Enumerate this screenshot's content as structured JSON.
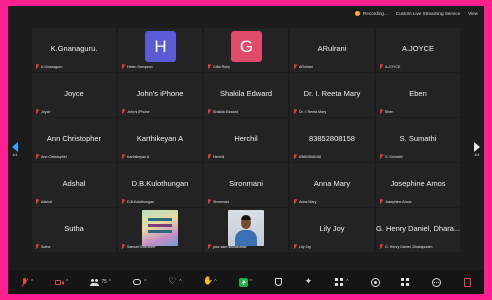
{
  "topbar": {
    "recording": "Recording...",
    "streaming": "Custom Live Streaming Service",
    "view": "View"
  },
  "nav": {
    "left_page": "4/4",
    "right_page": "4/4"
  },
  "participants": [
    {
      "name": "K.Gnanaguru.",
      "label": "K.Gnanaguru"
    },
    {
      "avatar": "H",
      "color": "#5b5bd6",
      "label": "Helen Sampson"
    },
    {
      "avatar": "G",
      "color": "#e04b6c",
      "label": "Gifta Ruby"
    },
    {
      "name": "ARulrani",
      "label": "ARulrani"
    },
    {
      "name": "A.JOYCE",
      "label": "A.JOYCE"
    },
    {
      "name": "Joyce",
      "label": "Joyce"
    },
    {
      "name": "John's iPhone",
      "label": "John's iPhone"
    },
    {
      "name": "Shakila Edward",
      "label": "Shakila Edward"
    },
    {
      "name": "Dr. I. Reeta Mary",
      "label": "Dr. I. Reeta Mary"
    },
    {
      "name": "Eben",
      "label": "Eben"
    },
    {
      "name": "Ann Christopher",
      "label": "Ann Christopher"
    },
    {
      "name": "Karthikeyan A",
      "label": "Karthikeyan A"
    },
    {
      "name": "Herchil",
      "label": "Herchil"
    },
    {
      "name": "83852808158",
      "label": "83852808158"
    },
    {
      "name": "S. Sumathi",
      "label": "S. Sumathi"
    },
    {
      "name": "Adshal",
      "label": "Adshal"
    },
    {
      "name": "D.B.Kulothungan",
      "label": "D.B.Kulothungan"
    },
    {
      "name": "Sironmani",
      "label": "Sironmani"
    },
    {
      "name": "Anna Mary",
      "label": "Anna Mary"
    },
    {
      "name": "Josephine Amos",
      "label": "Josephine Amos"
    },
    {
      "name": "Sutha",
      "label": "Sutha"
    },
    {
      "photo": "book",
      "label": "Samuel Ebenezer"
    },
    {
      "photo": "person",
      "label": "jose sam selvakumar"
    },
    {
      "name": "Lily Joy",
      "label": "Lily Joy"
    },
    {
      "name": "G. Henry Daniel, Dhara...",
      "label": "G. Henry Daniel, Dharapuram"
    }
  ],
  "toolbar": {
    "participants_count": "75",
    "icons": [
      "mic-muted-icon",
      "video-off-icon",
      "participants-icon",
      "chat-icon",
      "reactions-icon",
      "raise-hand-icon",
      "share-screen-icon",
      "security-icon",
      "ai-companion-icon",
      "apps-icon",
      "record-icon",
      "more-icon",
      "end-icon"
    ]
  },
  "colors": {
    "frame_border": "#ff1f8e",
    "tile_bg": "#232323",
    "muted_red": "#e03b3b"
  }
}
